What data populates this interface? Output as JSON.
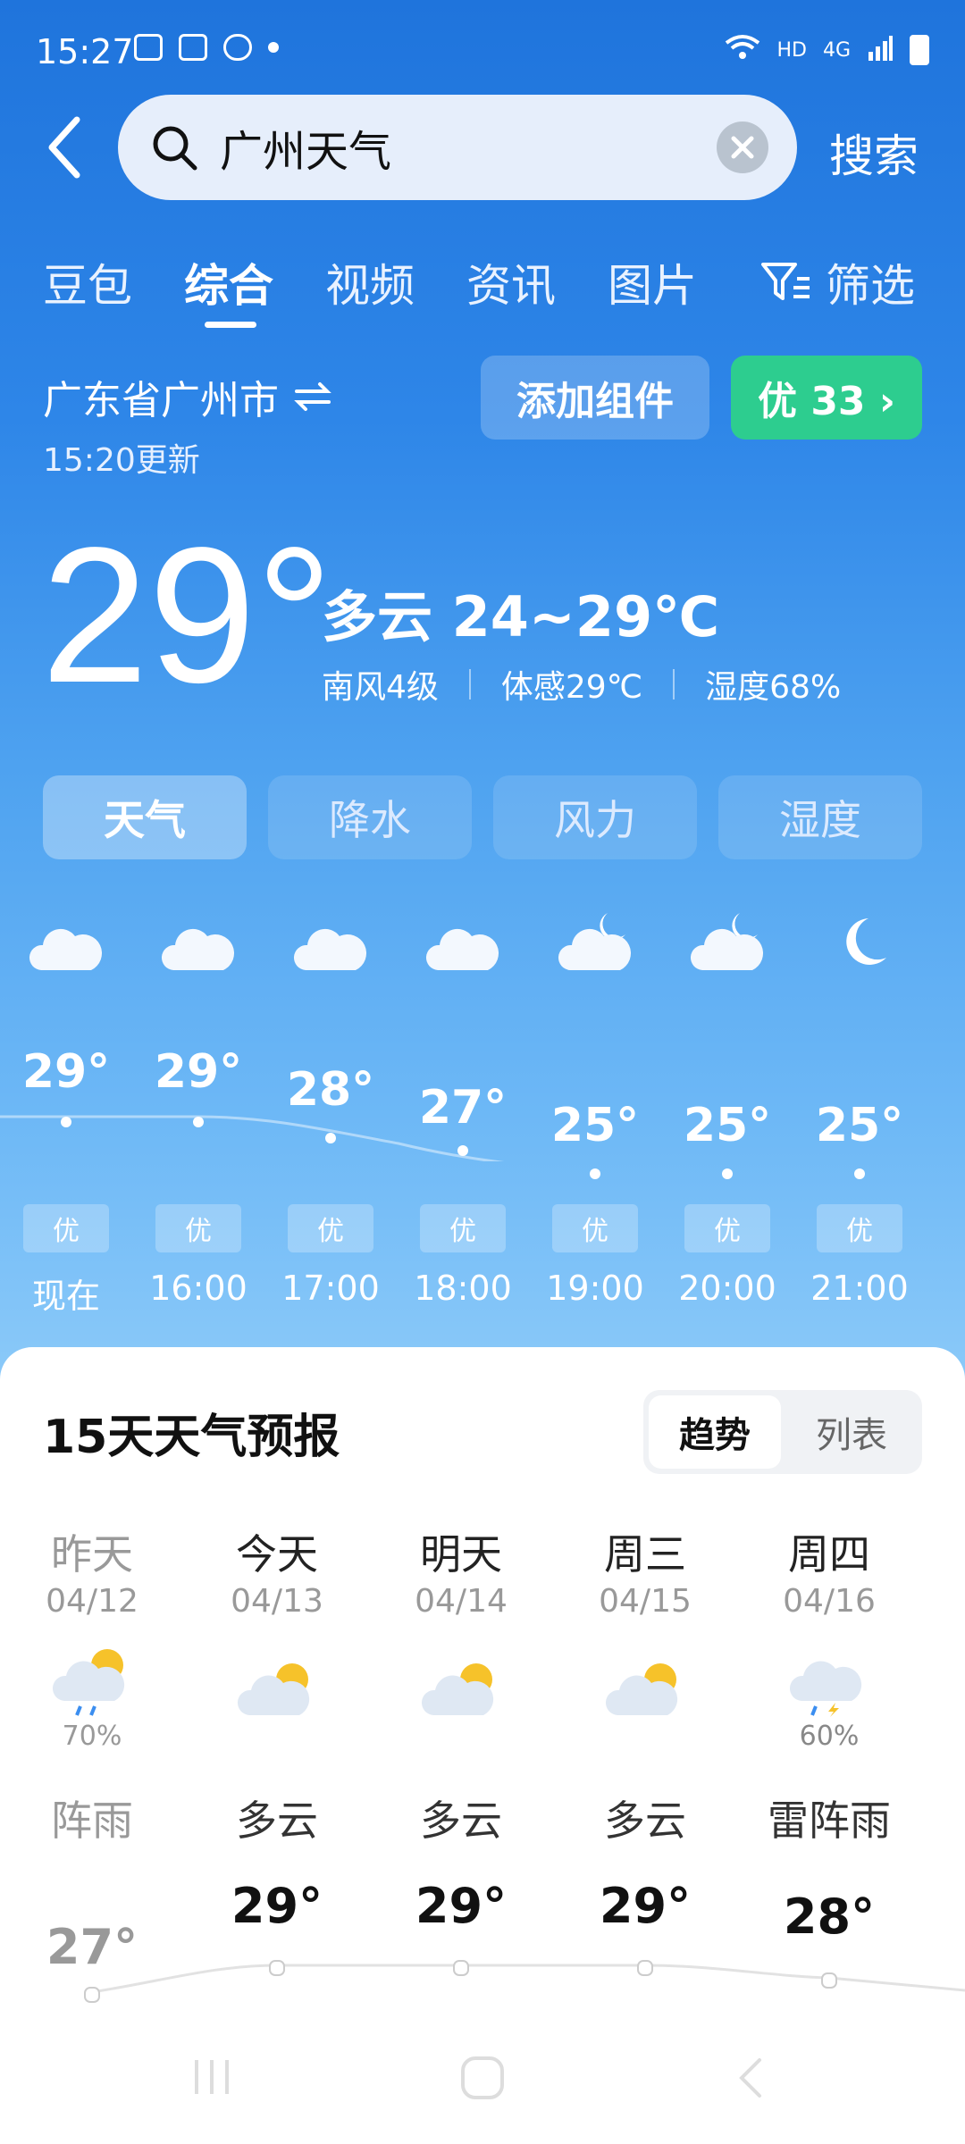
{
  "status_bar": {
    "time": "15:27",
    "network": "HD",
    "signal": "4G"
  },
  "search": {
    "query": "广州天气",
    "button": "搜索"
  },
  "tabs": [
    {
      "label": "豆包"
    },
    {
      "label": "综合"
    },
    {
      "label": "视频"
    },
    {
      "label": "资讯"
    },
    {
      "label": "图片"
    },
    {
      "label": "筛选"
    }
  ],
  "location": {
    "name": "广东省广州市",
    "updated": "15:20更新"
  },
  "actions": {
    "add_widget": "添加组件",
    "aqi": "优 33 ›"
  },
  "current": {
    "temp": "29°",
    "condition": "多云 24~29℃",
    "wind": "南风4级",
    "feels": "体感29℃",
    "humidity": "湿度68%"
  },
  "metric_tabs": [
    {
      "label": "天气"
    },
    {
      "label": "降水"
    },
    {
      "label": "风力"
    },
    {
      "label": "湿度"
    }
  ],
  "hourly": [
    {
      "time": "现在",
      "temp": "29°",
      "aqi": "优",
      "icon": "cloudy-icon"
    },
    {
      "time": "16:00",
      "temp": "29°",
      "aqi": "优",
      "icon": "cloudy-icon"
    },
    {
      "time": "17:00",
      "temp": "28°",
      "aqi": "优",
      "icon": "cloudy-icon"
    },
    {
      "time": "18:00",
      "temp": "27°",
      "aqi": "优",
      "icon": "cloudy-icon"
    },
    {
      "time": "19:00",
      "temp": "25°",
      "aqi": "优",
      "icon": "cloudy-night-icon"
    },
    {
      "time": "20:00",
      "temp": "25°",
      "aqi": "优",
      "icon": "cloudy-night-icon"
    },
    {
      "time": "21:00",
      "temp": "25°",
      "aqi": "优",
      "icon": "moon-icon"
    }
  ],
  "forecast": {
    "title": "15天天气预报",
    "toggle_trend": "趋势",
    "toggle_list": "列表",
    "days": [
      {
        "name": "昨天",
        "date": "04/12",
        "precip": "70%",
        "condition": "阵雨",
        "high": "27°",
        "icon": "rain-icon"
      },
      {
        "name": "今天",
        "date": "04/13",
        "precip": "",
        "condition": "多云",
        "high": "29°",
        "icon": "partly-cloudy-icon"
      },
      {
        "name": "明天",
        "date": "04/14",
        "precip": "",
        "condition": "多云",
        "high": "29°",
        "icon": "partly-cloudy-icon"
      },
      {
        "name": "周三",
        "date": "04/15",
        "precip": "",
        "condition": "多云",
        "high": "29°",
        "icon": "partly-cloudy-icon"
      },
      {
        "name": "周四",
        "date": "04/16",
        "precip": "60%",
        "condition": "雷阵雨",
        "high": "28°",
        "icon": "thunder-icon"
      }
    ]
  },
  "colors": {
    "aqi_green": "#2dcd8f",
    "sky_top": "#1f74dc",
    "sky_bottom": "#8ccaf9"
  }
}
